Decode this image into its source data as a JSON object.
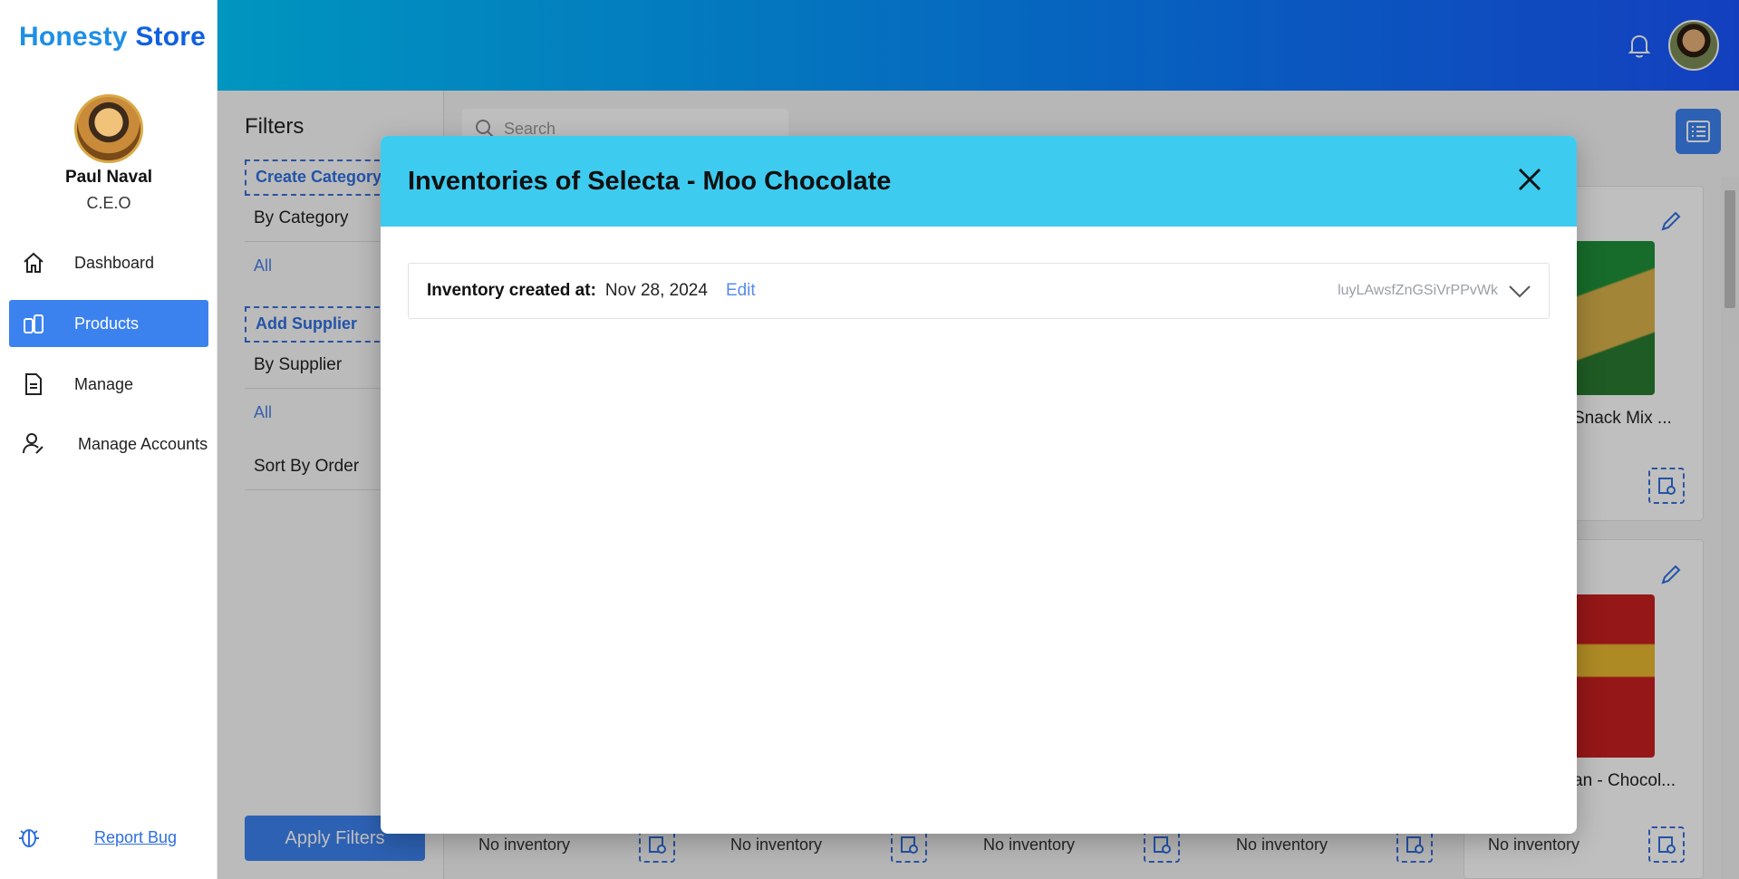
{
  "app": {
    "brand_a": "Honesty",
    "brand_b": "Store"
  },
  "user": {
    "name": "Paul Naval",
    "role": "C.E.O"
  },
  "nav": [
    {
      "label": "Dashboard",
      "icon": "home-icon",
      "active": false
    },
    {
      "label": "Products",
      "icon": "products-icon",
      "active": true
    },
    {
      "label": "Manage",
      "icon": "manage-icon",
      "active": false
    },
    {
      "label": "Manage Accounts",
      "icon": "accounts-icon",
      "active": false
    }
  ],
  "report_bug": "Report Bug",
  "filters": {
    "title": "Filters",
    "create_category": "Create Category",
    "by_category": "By Category",
    "category_value": "All",
    "add_supplier": "Add Supplier",
    "by_supplier": "By Supplier",
    "supplier_value": "All",
    "sort_by_order": "Sort By Order",
    "apply": "Apply Filters"
  },
  "search": {
    "placeholder": "Search"
  },
  "products": {
    "card1_name": "Snack Mix ...",
    "card2_name": "an - Chocol...",
    "no_inventory": "No inventory"
  },
  "modal": {
    "title": "Inventories of Selecta - Moo Chocolate",
    "inventory": {
      "label": "Inventory created at:",
      "date": "Nov 28, 2024",
      "edit": "Edit",
      "id": "luyLAwsfZnGSiVrPPvWk"
    }
  },
  "colors": {
    "accent": "#3c82ef",
    "modal_header": "#3ecbf0",
    "header_start": "#00c8ff",
    "header_end": "#1a55ff"
  }
}
